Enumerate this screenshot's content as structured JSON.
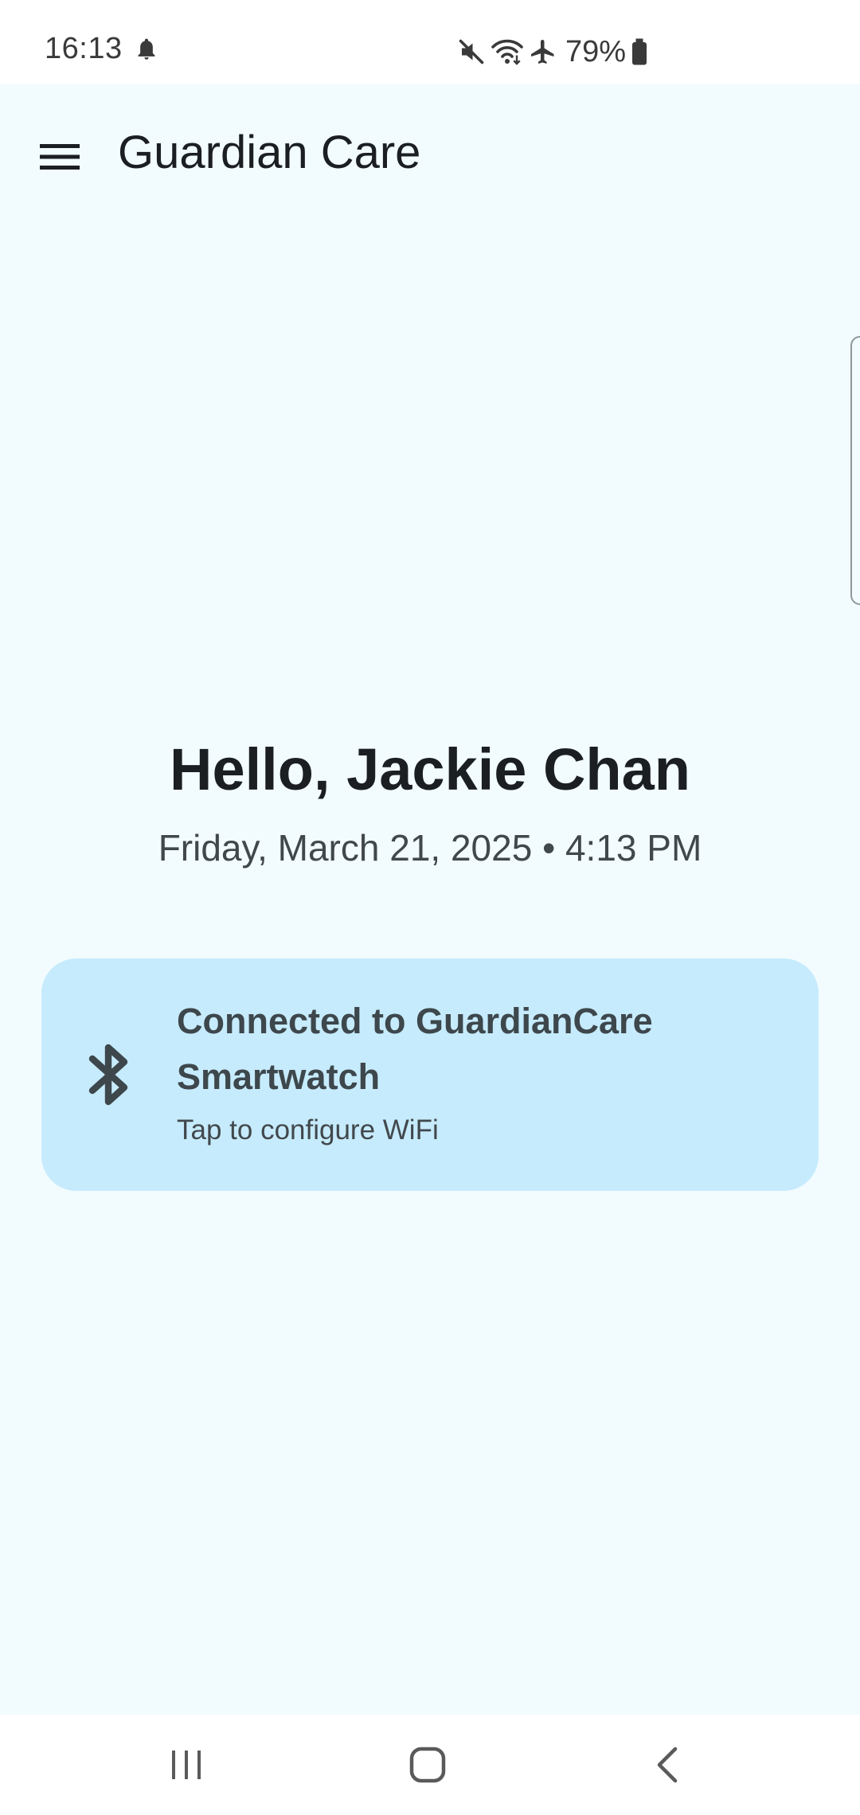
{
  "status_bar": {
    "time": "16:13",
    "battery": "79%",
    "icons": [
      "notification-bell-icon",
      "mute-icon",
      "wifi-icon",
      "airplane-icon",
      "battery-icon"
    ]
  },
  "app_bar": {
    "title": "Guardian Care",
    "menu_icon": "hamburger-menu-icon"
  },
  "greeting": {
    "text": "Hello, Jackie Chan",
    "datetime": "Friday, March 21, 2025 • 4:13 PM"
  },
  "device_card": {
    "icon": "bluetooth-icon",
    "title": "Connected to GuardianCare Smartwatch",
    "subtitle": "Tap to configure WiFi"
  },
  "nav_bar": {
    "buttons": [
      "recent-apps-icon",
      "home-icon",
      "back-icon"
    ]
  },
  "colors": {
    "background": "#f2fbfe",
    "card": "#c6ebfc",
    "text_primary": "#1b1f22",
    "text_secondary": "#41484c"
  }
}
